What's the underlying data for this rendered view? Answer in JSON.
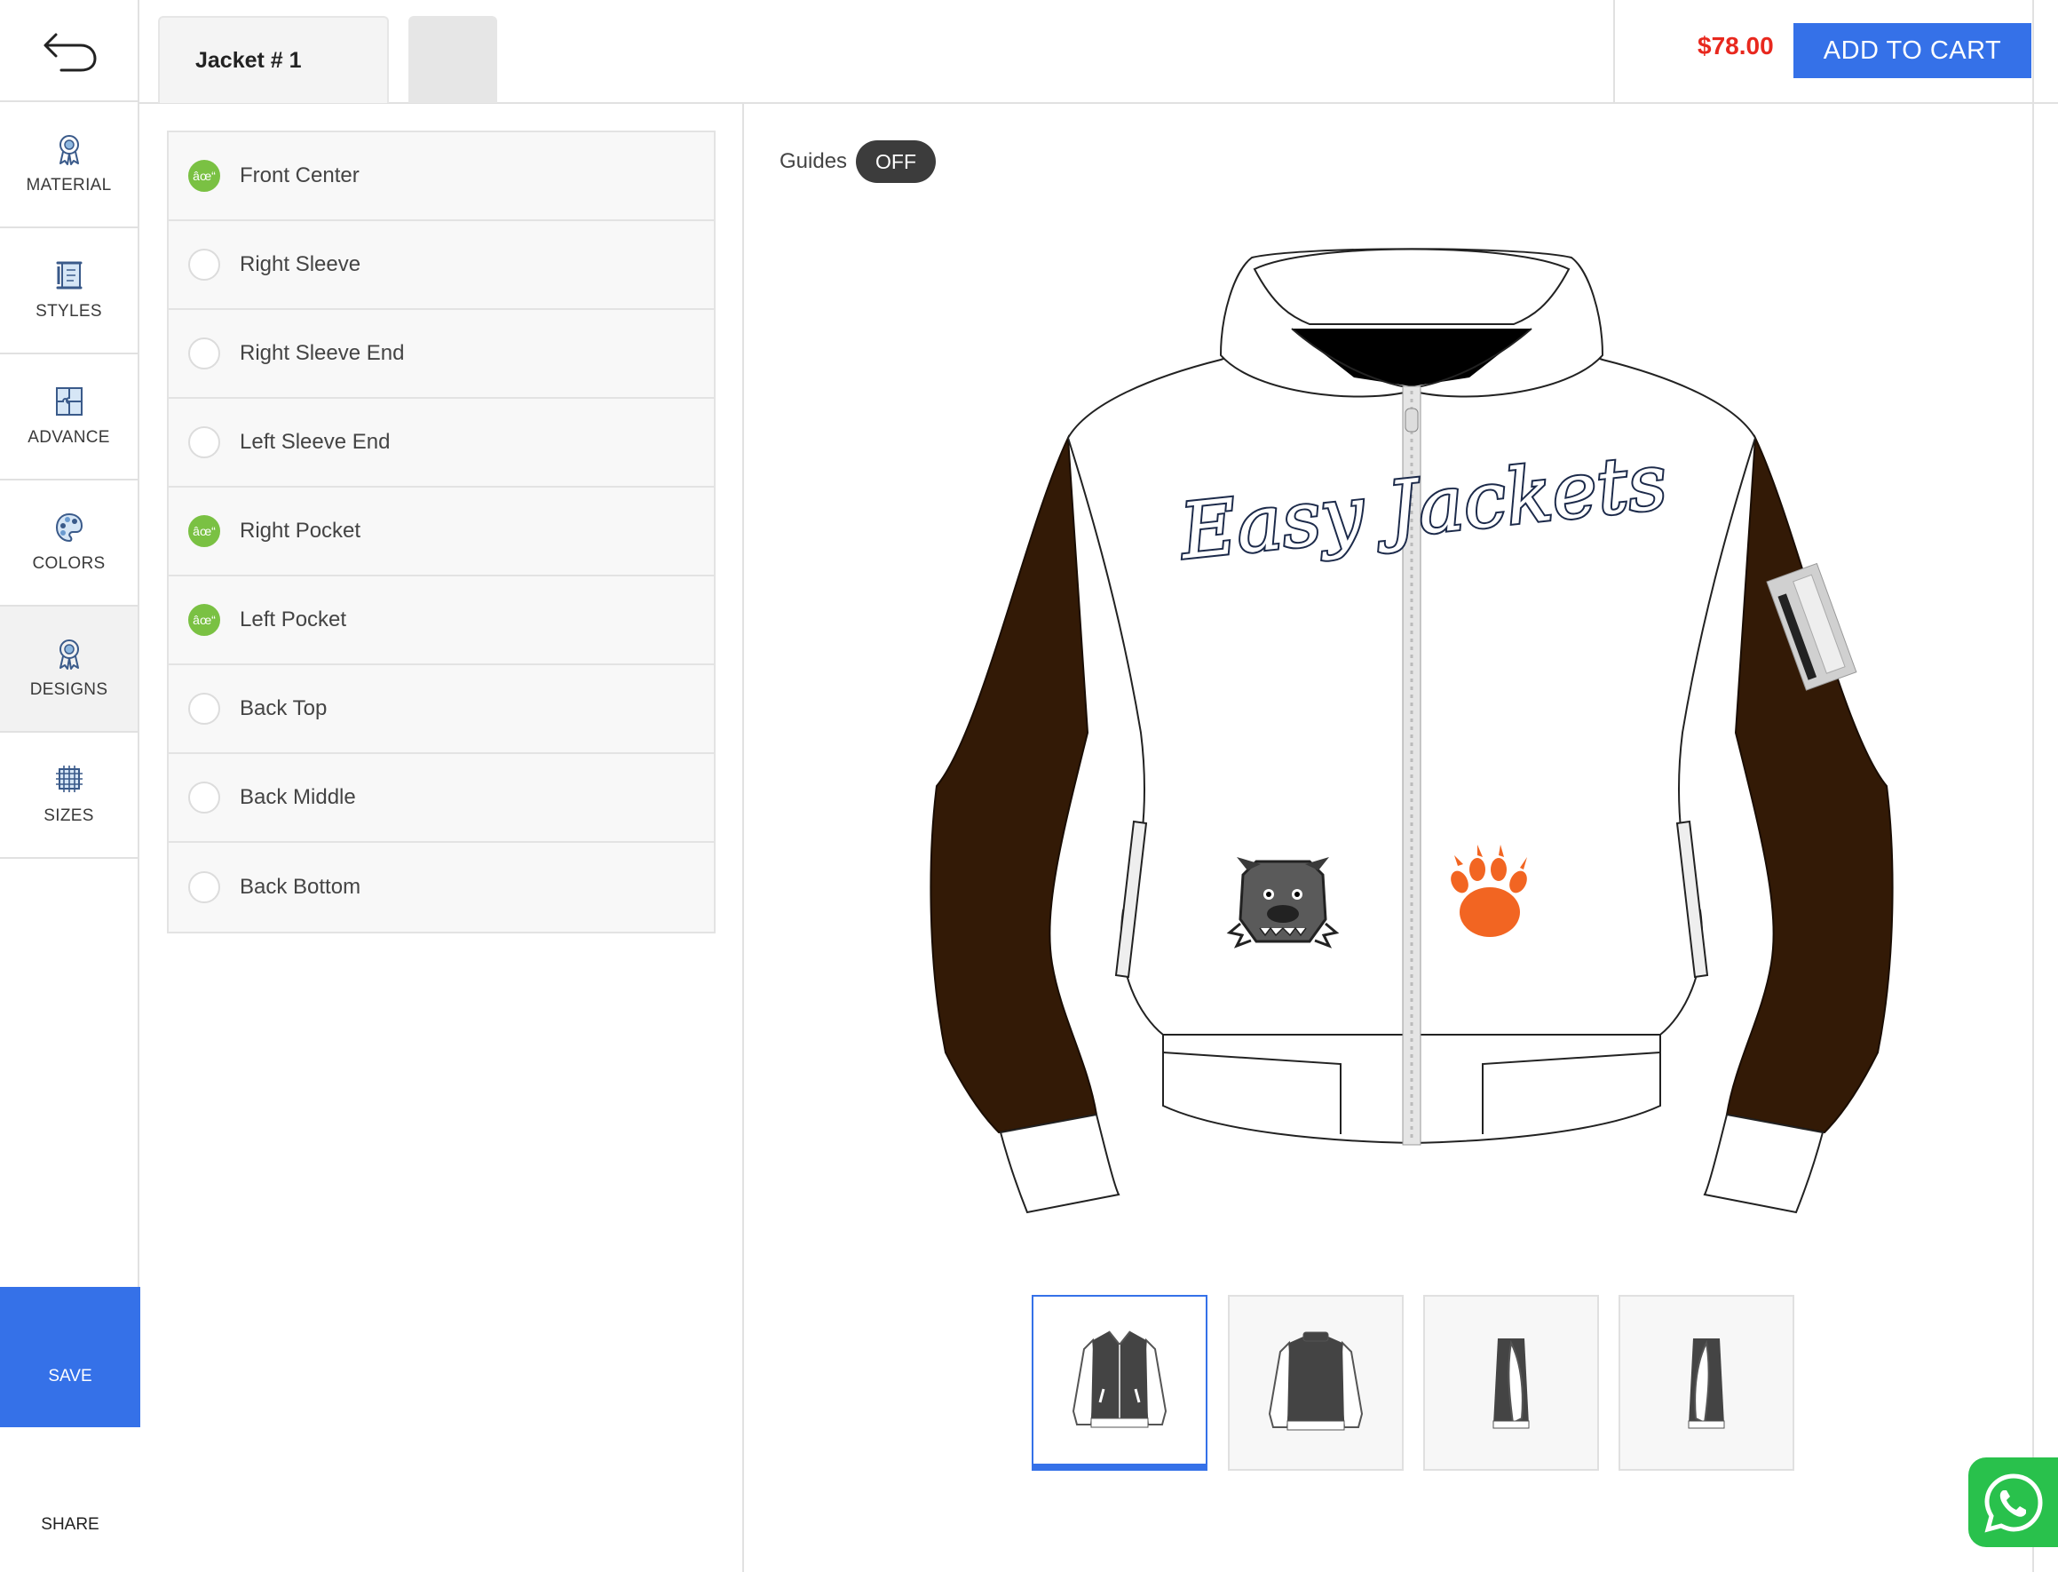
{
  "topbar": {
    "tab_label": "Jacket # 1",
    "price": "$78.00",
    "cart_label": "ADD TO CART"
  },
  "sidebar": {
    "items": [
      {
        "label": "MATERIAL",
        "icon": "ribbon-icon"
      },
      {
        "label": "STYLES",
        "icon": "scroll-icon"
      },
      {
        "label": "ADVANCE",
        "icon": "puzzle-icon"
      },
      {
        "label": "COLORS",
        "icon": "palette-icon"
      },
      {
        "label": "DESIGNS",
        "icon": "ribbon-icon"
      },
      {
        "label": "SIZES",
        "icon": "grid-icon"
      }
    ],
    "active": "DESIGNS",
    "save_label": "SAVE",
    "share_label": "SHARE"
  },
  "positions": [
    {
      "label": "Front Center",
      "checked": true,
      "mark": "âœ“"
    },
    {
      "label": "Right Sleeve",
      "checked": false,
      "mark": ""
    },
    {
      "label": "Right Sleeve End",
      "checked": false,
      "mark": ""
    },
    {
      "label": "Left Sleeve End",
      "checked": false,
      "mark": ""
    },
    {
      "label": "Right Pocket",
      "checked": true,
      "mark": "âœ“"
    },
    {
      "label": "Left Pocket",
      "checked": true,
      "mark": "âœ“"
    },
    {
      "label": "Back Top",
      "checked": false,
      "mark": ""
    },
    {
      "label": "Back Middle",
      "checked": false,
      "mark": ""
    },
    {
      "label": "Back Bottom",
      "checked": false,
      "mark": ""
    }
  ],
  "preview": {
    "guides_label": "Guides",
    "guides_state": "OFF",
    "jacket_text": "Easy Jackets",
    "colors": {
      "body": "#ffffff",
      "sleeves": "#331a06",
      "paw": "#f26522",
      "text_fill": "#ffffff",
      "text_stroke": "#1c2a4a",
      "accent": "#3571e8",
      "price": "#e8281e"
    },
    "thumbnails": [
      "front-view",
      "back-view",
      "left-side-view",
      "right-side-view"
    ],
    "active_thumbnail": "front-view"
  }
}
